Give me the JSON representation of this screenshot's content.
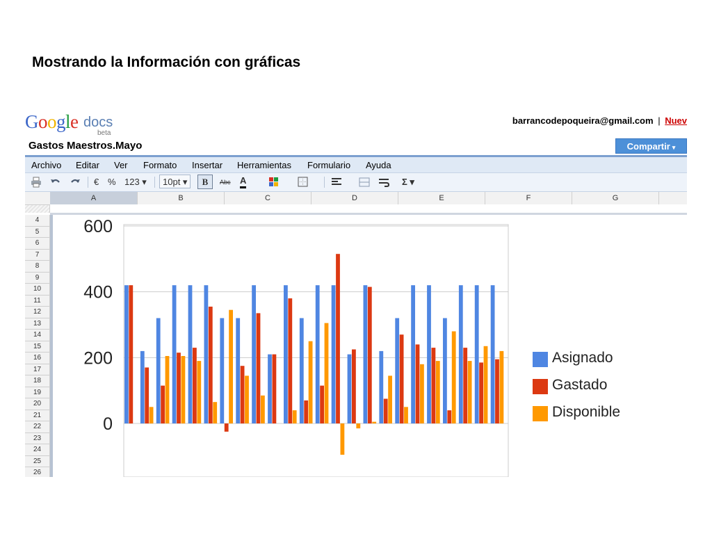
{
  "slide": {
    "title": "Mostrando la Información con gráficas"
  },
  "app": {
    "logo": {
      "google": "Google",
      "docs": "docs",
      "beta": "beta"
    },
    "user_email": "barrancodepoqueira@gmail.com",
    "separator": "|",
    "new_link": "Nuev",
    "doc_title": "Gastos Maestros.Mayo",
    "share_button": "Compartir",
    "share_caret": "▾",
    "colors": {
      "accent": "#4d90d8",
      "menubar": "#dfe9f5",
      "link_red": "#cc0000"
    }
  },
  "menu": [
    "Archivo",
    "Editar",
    "Ver",
    "Formato",
    "Insertar",
    "Herramientas",
    "Formulario",
    "Ayuda"
  ],
  "toolbar": {
    "print_icon": "printer-icon",
    "undo_icon": "undo-icon",
    "redo_icon": "redo-icon",
    "currency": "€",
    "percent": "%",
    "number_format": "123 ▾",
    "font_size": "10pt ▾",
    "bold": "B",
    "strike": "Abc",
    "text_color": "A",
    "fill_icon": "fill-color-icon",
    "borders_icon": "borders-icon",
    "align_icon": "align-icon",
    "merge_icon": "merge-icon",
    "wrap_icon": "wrap-icon",
    "sum": "Σ ▾"
  },
  "columns": [
    "A",
    "B",
    "C",
    "D",
    "E",
    "F",
    "G"
  ],
  "rows": [
    "4",
    "5",
    "6",
    "7",
    "8",
    "9",
    "10",
    "11",
    "12",
    "13",
    "14",
    "15",
    "16",
    "17",
    "18",
    "19",
    "20",
    "21",
    "22",
    "23",
    "24",
    "25",
    "26"
  ],
  "chart_data": {
    "type": "bar",
    "y_ticks": [
      "600",
      "400",
      "200",
      "0"
    ],
    "ylim": [
      -110,
      600
    ],
    "grid": true,
    "legend_position": "right",
    "series": [
      {
        "name": "Asignado",
        "color": "#4f86e2",
        "values": [
          420,
          220,
          320,
          420,
          420,
          420,
          320,
          320,
          420,
          210,
          420,
          320,
          420,
          420,
          210,
          420,
          220,
          320,
          420,
          420,
          320,
          420,
          420,
          420
        ]
      },
      {
        "name": "Gastado",
        "color": "#dc3912",
        "values": [
          420,
          170,
          115,
          215,
          230,
          355,
          -25,
          175,
          335,
          210,
          380,
          70,
          115,
          515,
          225,
          415,
          75,
          270,
          240,
          230,
          40,
          230,
          185,
          195
        ]
      },
      {
        "name": "Disponible",
        "color": "#ff9900",
        "values": [
          0,
          50,
          205,
          205,
          190,
          65,
          345,
          145,
          85,
          0,
          40,
          250,
          305,
          -95,
          -15,
          5,
          145,
          50,
          180,
          190,
          280,
          190,
          235,
          220
        ]
      }
    ]
  }
}
